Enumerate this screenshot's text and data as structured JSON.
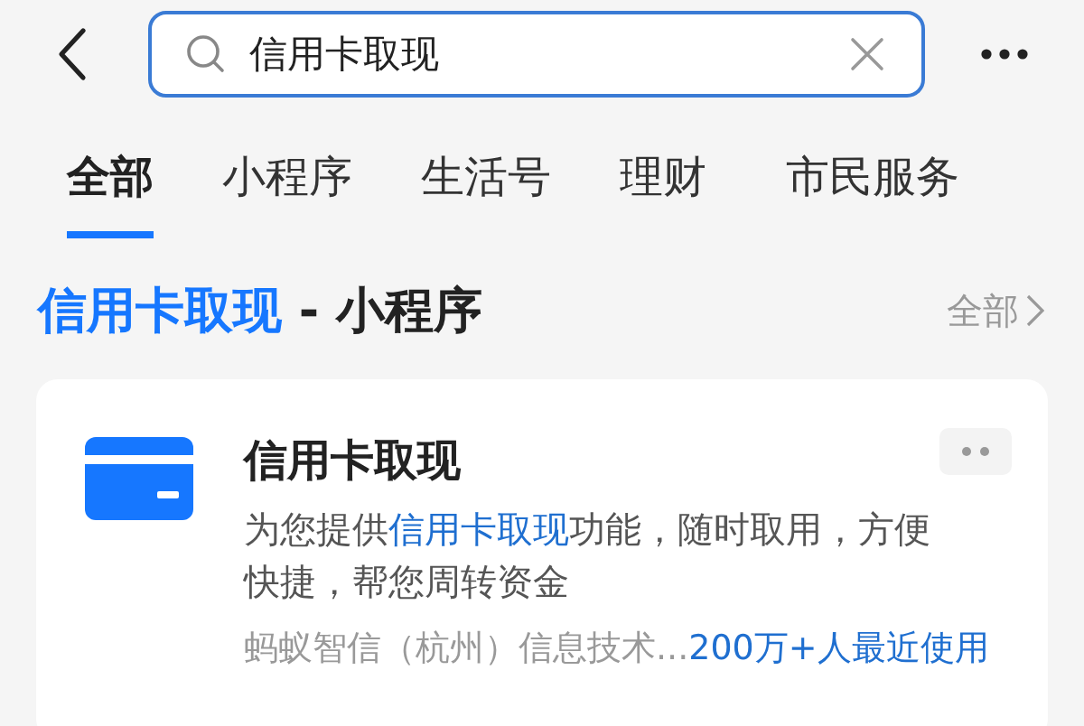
{
  "search": {
    "value": "信用卡取现"
  },
  "tabs": [
    {
      "label": "全部",
      "selected": true
    },
    {
      "label": "小程序",
      "selected": false
    },
    {
      "label": "生活号",
      "selected": false
    },
    {
      "label": "理财",
      "selected": false
    },
    {
      "label": "市民服务",
      "selected": false
    }
  ],
  "section": {
    "title": [
      {
        "text": "信用卡取现",
        "highlight": true
      },
      {
        "text": " - 小程序",
        "highlight": false
      }
    ],
    "more": "全部"
  },
  "result": {
    "title": "信用卡取现",
    "description": [
      {
        "text": "为您提供",
        "highlight": false
      },
      {
        "text": "信用卡取现",
        "highlight": true
      },
      {
        "text": "功能，随时取用，方便快捷，帮您周转资金",
        "highlight": false
      }
    ],
    "provider": "蚂蚁智信（杭州）信息技术...",
    "usage": "200万+人最近使用"
  }
}
